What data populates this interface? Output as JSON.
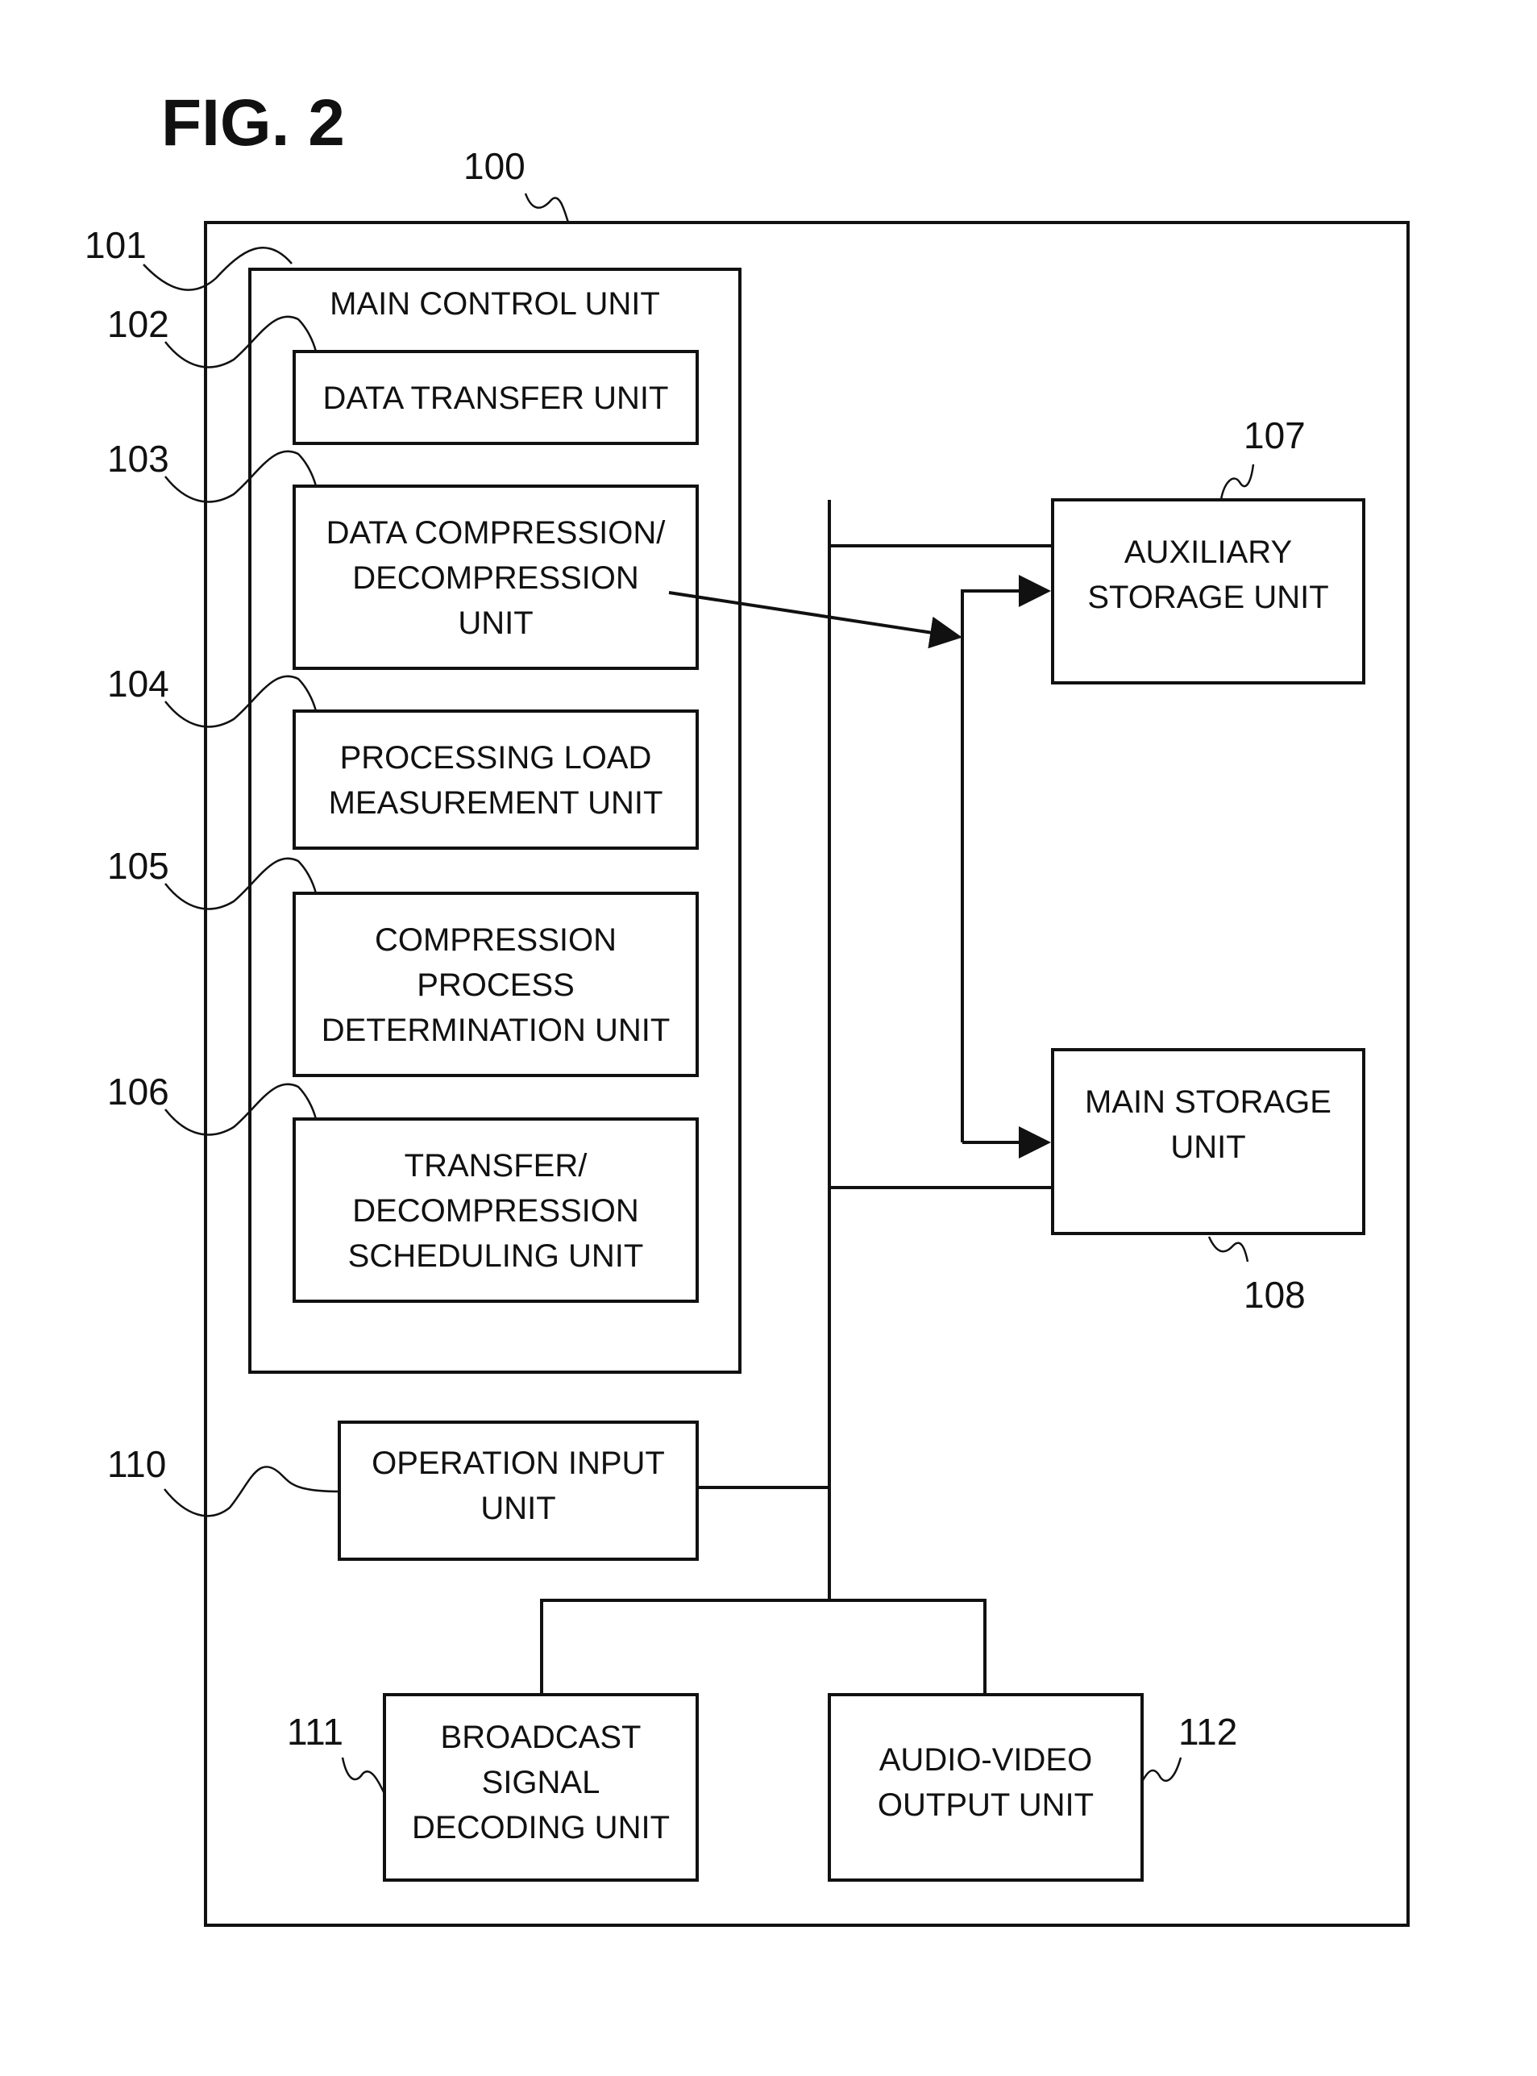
{
  "figure": {
    "title": "FIG. 2"
  },
  "device": {
    "ref": "100"
  },
  "main_control": {
    "ref": "101",
    "label": "MAIN CONTROL UNIT",
    "units": [
      {
        "ref": "102",
        "lines": [
          "DATA TRANSFER UNIT"
        ]
      },
      {
        "ref": "103",
        "lines": [
          "DATA COMPRESSION/",
          "DECOMPRESSION",
          "UNIT"
        ]
      },
      {
        "ref": "104",
        "lines": [
          "PROCESSING LOAD",
          "MEASUREMENT UNIT"
        ]
      },
      {
        "ref": "105",
        "lines": [
          "COMPRESSION",
          "PROCESS",
          "DETERMINATION UNIT"
        ]
      },
      {
        "ref": "106",
        "lines": [
          "TRANSFER/",
          "DECOMPRESSION",
          "SCHEDULING UNIT"
        ]
      }
    ]
  },
  "auxiliary_storage": {
    "ref": "107",
    "lines": [
      "AUXILIARY",
      "STORAGE UNIT"
    ]
  },
  "main_storage": {
    "ref": "108",
    "lines": [
      "MAIN STORAGE",
      "UNIT"
    ]
  },
  "operation_input": {
    "ref": "110",
    "lines": [
      "OPERATION INPUT",
      "UNIT"
    ]
  },
  "broadcast_decoder": {
    "ref": "111",
    "lines": [
      "BROADCAST",
      "SIGNAL",
      "DECODING UNIT"
    ]
  },
  "av_output": {
    "ref": "112",
    "lines": [
      "AUDIO-VIDEO",
      "OUTPUT UNIT"
    ]
  }
}
